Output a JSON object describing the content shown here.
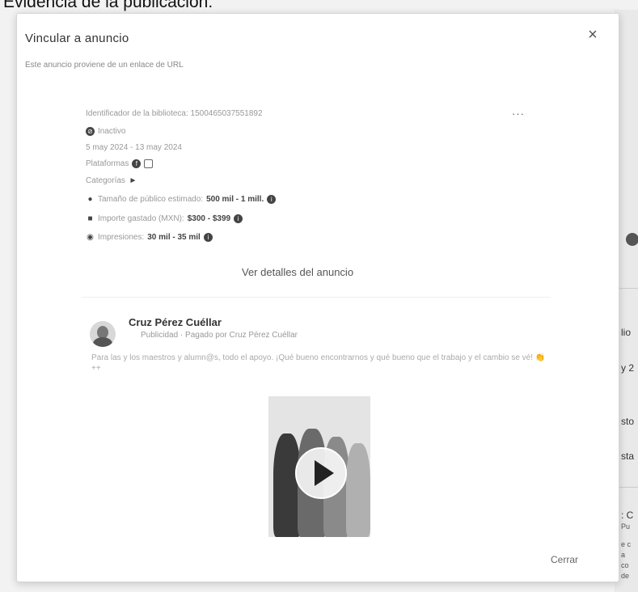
{
  "document_caption": "Evidencia de la publicación:",
  "modal": {
    "title": "Vincular a anuncio",
    "close_symbol": "×",
    "subtitle": "Este anuncio proviene de un enlace de URL",
    "more_symbol": "···",
    "footer_close": "Cerrar"
  },
  "ad": {
    "library_id": "Identificador de la biblioteca: 1500465037551892",
    "status": "Inactivo",
    "dates": "5 may 2024 - 13 may 2024",
    "platforms_label": "Plataformas",
    "platform_icons": [
      "facebook-icon",
      "instagram-icon"
    ],
    "categories_label": "Categorías",
    "category_icon": "megaphone-icon",
    "audience_label": "Tamaño de público estimado:",
    "audience_value": "500 mil - 1 mill.",
    "spend_label": "Importe gastado (MXN):",
    "spend_value": "$300 - $399",
    "impressions_label": "Impresiones:",
    "impressions_value": "30 mil - 35 mil",
    "details_link": "Ver detalles del anuncio"
  },
  "post": {
    "author": "Cruz Pérez Cuéllar",
    "meta": "Publicidad · Pagado por Cruz Pérez Cuéllar",
    "text": "Para las y los maestros y alumn@s, todo el apoyo. ¡Qué bueno encontrarnos y qué bueno que el trabajo y el cambio se vé! 👏 ++"
  },
  "background_fragments": [
    "lio",
    "y 2",
    "sto",
    "sta",
    ": C",
    "Pu",
    "e c",
    "a",
    "co",
    "de"
  ]
}
